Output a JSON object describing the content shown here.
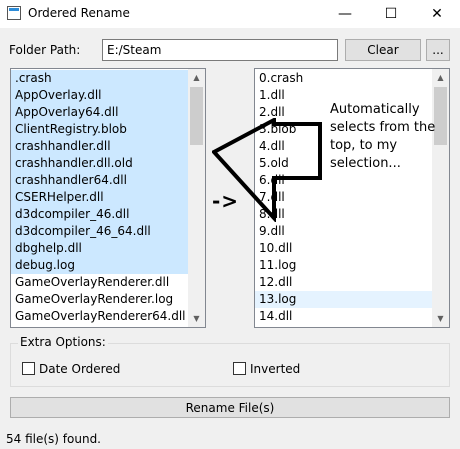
{
  "window": {
    "title": "Ordered Rename",
    "icon": "app-window-icon",
    "controls": {
      "minimize": "—",
      "maximize": "☐",
      "close": "✕"
    }
  },
  "folder": {
    "label": "Folder Path:",
    "value": "E:/Steam",
    "clear_label": "Clear",
    "browse_label": "..."
  },
  "left_list": {
    "items": [
      ".crash",
      "AppOverlay.dll",
      "AppOverlay64.dll",
      "ClientRegistry.blob",
      "crashhandler.dll",
      "crashhandler.dll.old",
      "crashhandler64.dll",
      "CSERHelper.dll",
      "d3dcompiler_46.dll",
      "d3dcompiler_46_64.dll",
      "dbghelp.dll",
      "debug.log",
      "GameOverlayRenderer.dll",
      "GameOverlayRenderer.log",
      "GameOverlayRenderer64.dll"
    ],
    "selected_count": 12,
    "selection_color": "#cce8ff"
  },
  "right_list": {
    "items": [
      "0.crash",
      "1.dll",
      "2.dll",
      "3.blob",
      "4.dll",
      "5.old",
      "6.dll",
      "7.dll",
      "8.dll",
      "9.dll",
      "10.dll",
      "11.log",
      "12.dll",
      "13.log",
      "14.dll"
    ],
    "hover_index": 13,
    "hover_color": "#e5f3ff"
  },
  "annotation": {
    "text": "Automatically selects from the top, to my selection...",
    "dash_arrow": "->"
  },
  "options": {
    "group_label": "Extra Options:",
    "date_ordered": {
      "label": "Date Ordered",
      "checked": false
    },
    "inverted": {
      "label": "Inverted",
      "checked": false
    }
  },
  "rename_label": "Rename File(s)",
  "status": "54 file(s) found."
}
